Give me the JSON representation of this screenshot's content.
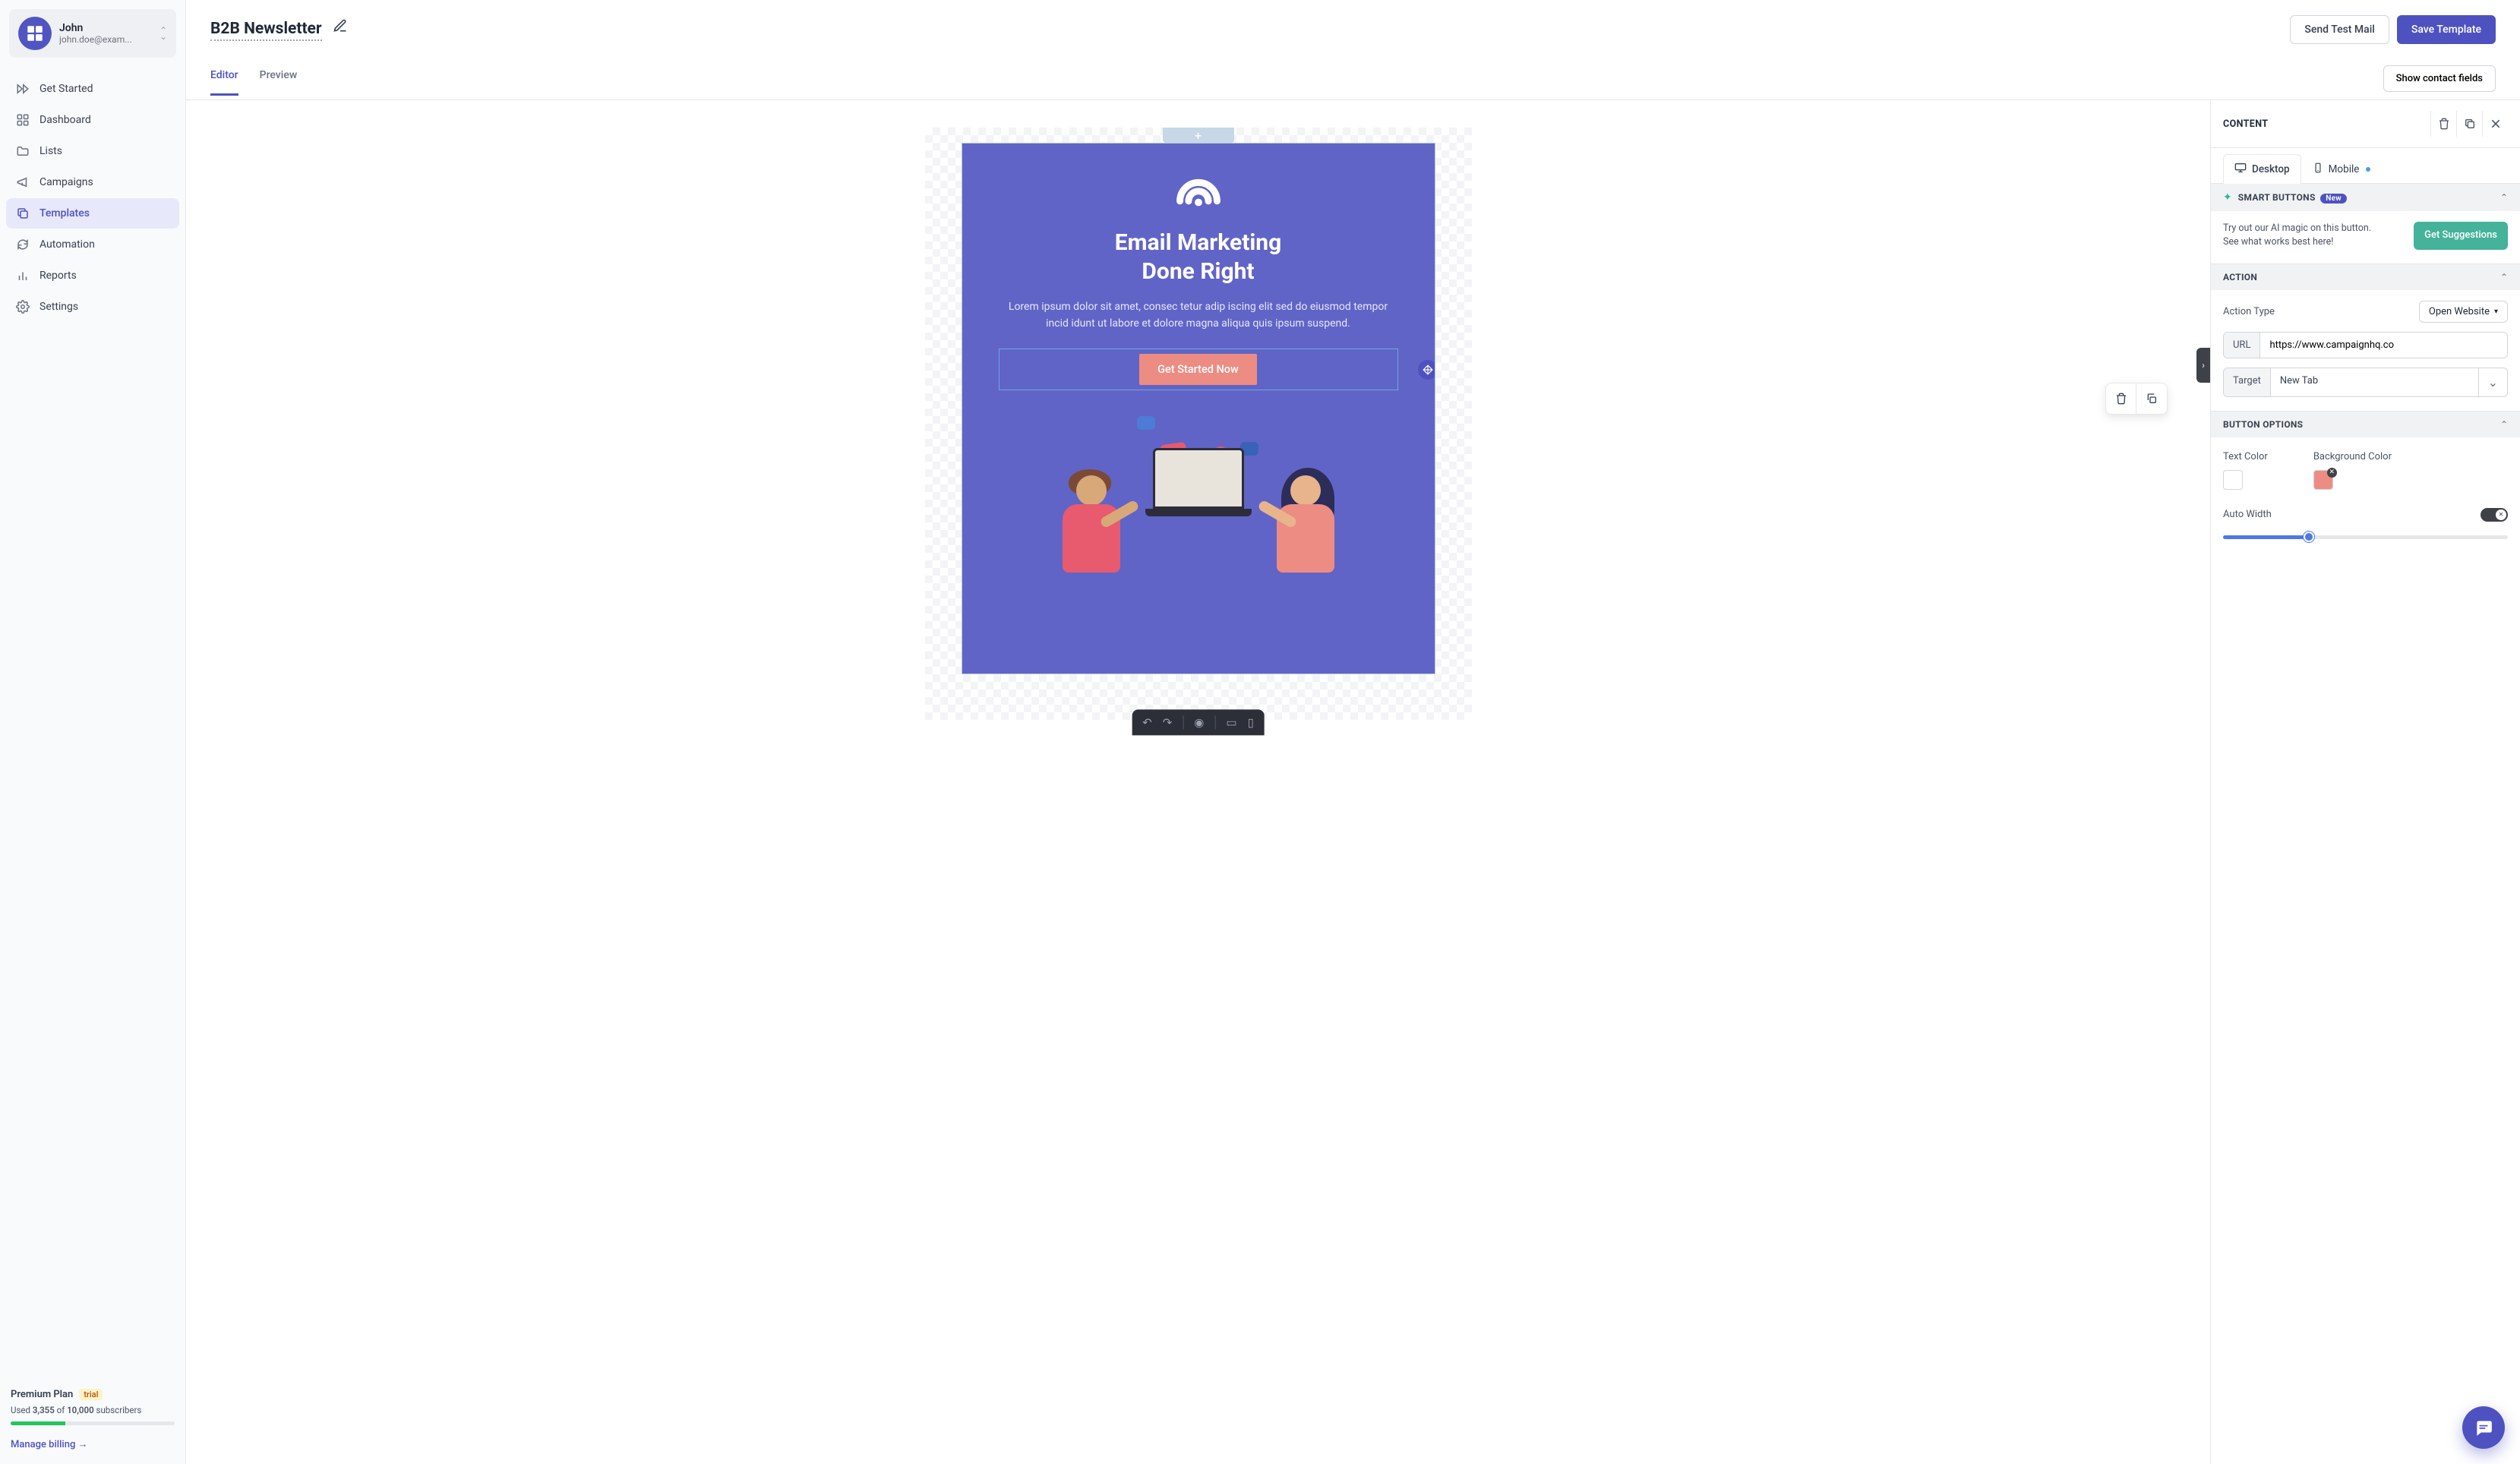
{
  "user": {
    "name": "John",
    "email": "john.doe@exam..."
  },
  "nav": {
    "getStarted": "Get Started",
    "dashboard": "Dashboard",
    "lists": "Lists",
    "campaigns": "Campaigns",
    "templates": "Templates",
    "automation": "Automation",
    "reports": "Reports",
    "settings": "Settings"
  },
  "plan": {
    "name": "Premium Plan",
    "badge": "trial",
    "usage_prefix": "Used ",
    "used": "3,355",
    "of": " of ",
    "total": "10,000",
    "suffix": " subscribers",
    "link": "Manage billing →"
  },
  "header": {
    "title": "B2B Newsletter",
    "sendTest": "Send Test Mail",
    "save": "Save Template"
  },
  "tabs": {
    "editor": "Editor",
    "preview": "Preview",
    "contactFields": "Show contact fields"
  },
  "canvas": {
    "heading_l1": "Email Marketing",
    "heading_l2": "Done Right",
    "paragraph": "Lorem ipsum dolor sit amet, consec tetur adip iscing elit sed do eiusmod tempor incid idunt ut labore et dolore magna aliqua quis ipsum suspend.",
    "cta": "Get Started Now"
  },
  "panel": {
    "contentLabel": "CONTENT",
    "desktop": "Desktop",
    "mobile": "Mobile",
    "smart": {
      "title": "SMART BUTTONS",
      "badge": "New",
      "text_l1": "Try out our AI magic on this button.",
      "text_l2": "See what works best here!",
      "cta": "Get Suggestions"
    },
    "action": {
      "title": "ACTION",
      "typeLabel": "Action Type",
      "typeValue": "Open Website",
      "urlLabel": "URL",
      "urlValue": "https://www.campaignhq.co",
      "targetLabel": "Target",
      "targetValue": "New Tab"
    },
    "buttonOpts": {
      "title": "BUTTON OPTIONS",
      "textColor": "Text Color",
      "bgColor": "Background Color",
      "autoWidth": "Auto Width",
      "textColorValue": "#ffffff",
      "bgColorValue": "#ed8c82"
    }
  }
}
